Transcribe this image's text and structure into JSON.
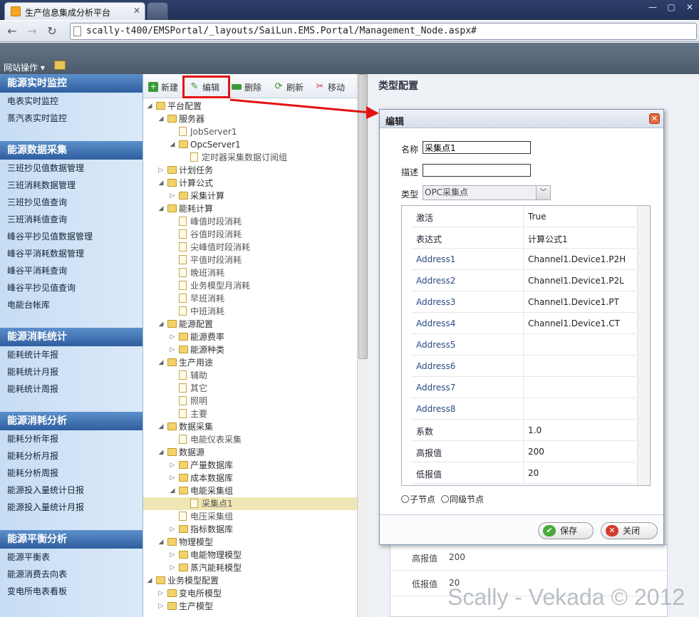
{
  "browser": {
    "tab_title": "生产信息集成分析平台",
    "url": "scally-t400/EMSPortal/_layouts/SaiLun.EMS.Portal/Management_Node.aspx#"
  },
  "site": {
    "actions_label": "网站操作"
  },
  "nav": {
    "sections": [
      {
        "title": "能源实时监控",
        "items": [
          "电表实时监控",
          "蒸汽表实时监控"
        ]
      },
      {
        "title": "能源数据采集",
        "items": [
          "三班抄见值数据管理",
          "三班消耗数据管理",
          "三班抄见值查询",
          "三班消耗值查询",
          "峰谷平抄见值数据管理",
          "峰谷平消耗数据管理",
          "峰谷平消耗查询",
          "峰谷平抄见值查询",
          "电能台帐库"
        ]
      },
      {
        "title": "能源消耗统计",
        "items": [
          "能耗统计年报",
          "能耗统计月报",
          "能耗统计周报"
        ]
      },
      {
        "title": "能源消耗分析",
        "items": [
          "能耗分析年报",
          "能耗分析月报",
          "能耗分析周报",
          "能源投入量统计日报",
          "能源投入量统计月报"
        ]
      },
      {
        "title": "能源平衡分析",
        "items": [
          "能源平衡表",
          "能源消费去向表",
          "变电所电表看板"
        ]
      }
    ]
  },
  "toolbar": {
    "new": "新建",
    "edit": "编辑",
    "delete": "删除",
    "refresh": "刷新",
    "move": "移动"
  },
  "tree": [
    {
      "label": "平台配置",
      "level": 0,
      "type": "folder",
      "state": "open"
    },
    {
      "label": "服务器",
      "level": 1,
      "type": "folder",
      "state": "open"
    },
    {
      "label": "JobServer1",
      "level": 2,
      "type": "doc",
      "state": "leaf"
    },
    {
      "label": "OpcServer1",
      "level": 2,
      "type": "folder",
      "state": "open"
    },
    {
      "label": "定时器采集数据订阅组",
      "level": 3,
      "type": "doc",
      "state": "leaf"
    },
    {
      "label": "计划任务",
      "level": 1,
      "type": "folder",
      "state": "closed"
    },
    {
      "label": "计算公式",
      "level": 1,
      "type": "folder",
      "state": "open"
    },
    {
      "label": "采集计算",
      "level": 2,
      "type": "folder",
      "state": "closed"
    },
    {
      "label": "能耗计算",
      "level": 1,
      "type": "folder",
      "state": "open"
    },
    {
      "label": "峰值时段消耗",
      "level": 2,
      "type": "doc",
      "state": "leaf"
    },
    {
      "label": "谷值时段消耗",
      "level": 2,
      "type": "doc",
      "state": "leaf"
    },
    {
      "label": "尖峰值时段消耗",
      "level": 2,
      "type": "doc",
      "state": "leaf"
    },
    {
      "label": "平值时段消耗",
      "level": 2,
      "type": "doc",
      "state": "leaf"
    },
    {
      "label": "晚班消耗",
      "level": 2,
      "type": "doc",
      "state": "leaf"
    },
    {
      "label": "业务模型月消耗",
      "level": 2,
      "type": "doc",
      "state": "leaf"
    },
    {
      "label": "早班消耗",
      "level": 2,
      "type": "doc",
      "state": "leaf"
    },
    {
      "label": "中班消耗",
      "level": 2,
      "type": "doc",
      "state": "leaf"
    },
    {
      "label": "能源配置",
      "level": 1,
      "type": "folder",
      "state": "open"
    },
    {
      "label": "能源费率",
      "level": 2,
      "type": "folder",
      "state": "closed"
    },
    {
      "label": "能源种类",
      "level": 2,
      "type": "folder",
      "state": "closed"
    },
    {
      "label": "生产用途",
      "level": 1,
      "type": "folder",
      "state": "open"
    },
    {
      "label": "辅助",
      "level": 2,
      "type": "doc",
      "state": "leaf"
    },
    {
      "label": "其它",
      "level": 2,
      "type": "doc",
      "state": "leaf"
    },
    {
      "label": "照明",
      "level": 2,
      "type": "doc",
      "state": "leaf"
    },
    {
      "label": "主要",
      "level": 2,
      "type": "doc",
      "state": "leaf"
    },
    {
      "label": "数据采集",
      "level": 1,
      "type": "folder",
      "state": "open"
    },
    {
      "label": "电能仪表采集",
      "level": 2,
      "type": "doc",
      "state": "leaf"
    },
    {
      "label": "数据源",
      "level": 1,
      "type": "folder",
      "state": "open"
    },
    {
      "label": "产量数据库",
      "level": 2,
      "type": "folder",
      "state": "closed"
    },
    {
      "label": "成本数据库",
      "level": 2,
      "type": "folder",
      "state": "closed"
    },
    {
      "label": "电能采集组",
      "level": 2,
      "type": "folder",
      "state": "open"
    },
    {
      "label": "采集点1",
      "level": 3,
      "type": "doc",
      "state": "leaf",
      "selected": true
    },
    {
      "label": "电压采集组",
      "level": 2,
      "type": "doc",
      "state": "leaf"
    },
    {
      "label": "指标数据库",
      "level": 2,
      "type": "folder",
      "state": "closed"
    },
    {
      "label": "物理模型",
      "level": 1,
      "type": "folder",
      "state": "open"
    },
    {
      "label": "电能物理模型",
      "level": 2,
      "type": "folder",
      "state": "closed"
    },
    {
      "label": "蒸汽能耗模型",
      "level": 2,
      "type": "folder",
      "state": "closed"
    },
    {
      "label": "业务模型配置",
      "level": 0,
      "type": "folder",
      "state": "open"
    },
    {
      "label": "变电所模型",
      "level": 1,
      "type": "folder",
      "state": "closed"
    },
    {
      "label": "生产模型",
      "level": 1,
      "type": "folder",
      "state": "closed"
    }
  ],
  "right": {
    "title": "类型配置",
    "bg_rows": [
      {
        "label": "高报值",
        "value": "200"
      },
      {
        "label": "低报值",
        "value": "20"
      }
    ]
  },
  "dialog": {
    "title": "编辑",
    "name_label": "名称",
    "name_value": "采集点1",
    "desc_label": "描述",
    "desc_value": "",
    "type_label": "类型",
    "type_value": "OPC采集点",
    "props": [
      {
        "key": "激活",
        "value": "True",
        "blue": false
      },
      {
        "key": "表达式",
        "value": "计算公式1",
        "blue": false
      },
      {
        "key": "Address1",
        "value": "Channel1.Device1.P2H",
        "blue": true
      },
      {
        "key": "Address2",
        "value": "Channel1.Device1.P2L",
        "blue": true
      },
      {
        "key": "Address3",
        "value": "Channel1.Device1.PT",
        "blue": true
      },
      {
        "key": "Address4",
        "value": "Channel1.Device1.CT",
        "blue": true
      },
      {
        "key": "Address5",
        "value": "",
        "blue": true
      },
      {
        "key": "Address6",
        "value": "",
        "blue": true
      },
      {
        "key": "Address7",
        "value": "",
        "blue": true
      },
      {
        "key": "Address8",
        "value": "",
        "blue": true
      },
      {
        "key": "系数",
        "value": "1.0",
        "blue": false
      },
      {
        "key": "高报值",
        "value": "200",
        "blue": false
      },
      {
        "key": "低报值",
        "value": "20",
        "blue": false
      }
    ],
    "radio_child": "子节点",
    "radio_sibling": "同级节点",
    "save_label": "保存",
    "close_label": "关闭"
  },
  "watermark": "Scally - Vekada © 2012",
  "colors": {
    "highlight": "#e31212",
    "nav_header": "#2f5e9e",
    "selected_row": "#efe6b6"
  }
}
